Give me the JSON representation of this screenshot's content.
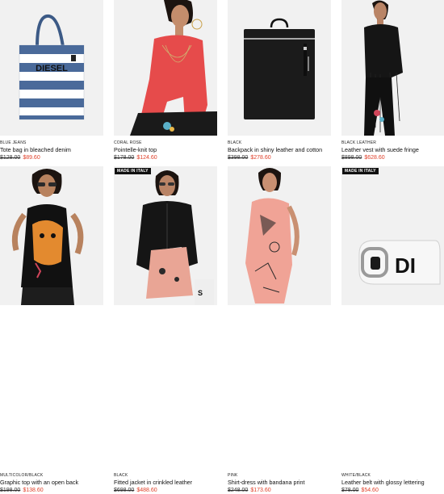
{
  "products": [
    {
      "color": "BLUE JEANS",
      "name": "Tote bag in bleached denim",
      "old_price": "$128.00",
      "new_price": "$89.60",
      "badge": ""
    },
    {
      "color": "CORAL ROSE",
      "name": "Pointelle-knit top",
      "old_price": "$178.00",
      "new_price": "$124.60",
      "badge": ""
    },
    {
      "color": "BLACK",
      "name": "Backpack in shiny leather and cotton",
      "old_price": "$398.00",
      "new_price": "$278.60",
      "badge": ""
    },
    {
      "color": "BLACK LEATHER",
      "name": "Leather vest with suede fringe",
      "old_price": "$898.00",
      "new_price": "$628.60",
      "badge": ""
    },
    {
      "color": "MULTICOLOR/BLACK",
      "name": "Graphic top with an open back",
      "old_price": "$198.00",
      "new_price": "$138.60",
      "badge": ""
    },
    {
      "color": "BLACK",
      "name": "Fitted jacket in crinkled leather",
      "old_price": "$698.00",
      "new_price": "$488.60",
      "badge": "MADE IN ITALY"
    },
    {
      "color": "PINK",
      "name": "Shirt-dress with bandana print",
      "old_price": "$248.00",
      "new_price": "$173.60",
      "badge": ""
    },
    {
      "color": "WHITE/BLACK",
      "name": "Leather belt with glossy lettering",
      "old_price": "$78.00",
      "new_price": "$54.60",
      "badge": "MADE IN ITALY"
    }
  ],
  "bag_logo": "DIESEL",
  "belt_lettering": "DI",
  "colors": {
    "sale": "#e0402a",
    "badge_bg": "#111111",
    "image_bg": "#f1f1f1"
  }
}
